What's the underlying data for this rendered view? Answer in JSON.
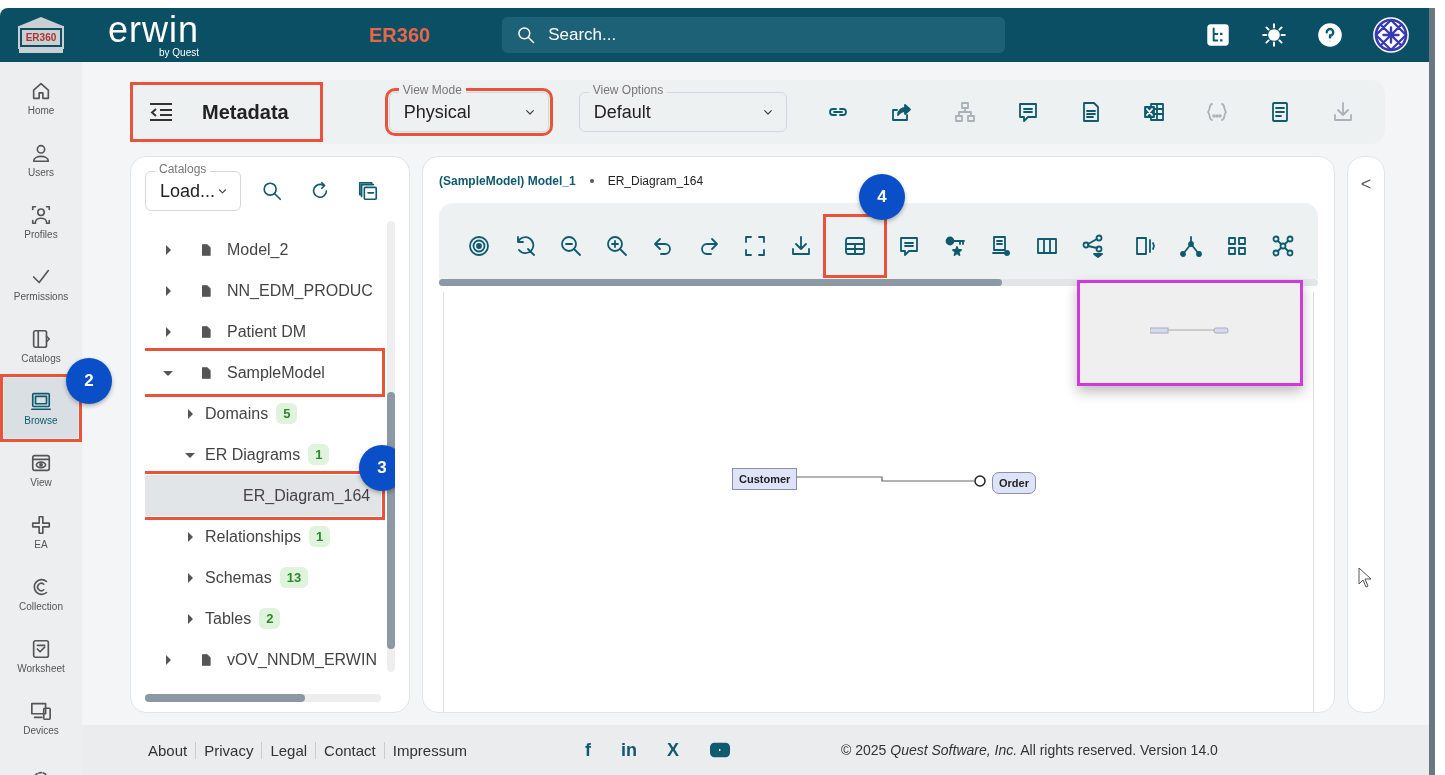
{
  "header": {
    "logo_badge": "ER360",
    "brand": "erwin",
    "brand_sub": "by Quest",
    "app_name": "ER360",
    "search": {
      "placeholder": "Search..."
    },
    "actions": [
      {
        "kind": "diagram"
      },
      {
        "kind": "theme"
      },
      {
        "kind": "help"
      },
      {
        "kind": "avatar"
      }
    ]
  },
  "nav": [
    {
      "kind": "home",
      "label": "Home",
      "selected": false,
      "highlighted": false
    },
    {
      "kind": "user",
      "label": "Users",
      "selected": false,
      "highlighted": false
    },
    {
      "kind": "profile",
      "label": "Profiles",
      "selected": false,
      "highlighted": false
    },
    {
      "kind": "check",
      "label": "Permissions",
      "selected": false,
      "highlighted": false
    },
    {
      "kind": "catalog",
      "label": "Catalogs",
      "selected": false,
      "highlighted": false
    },
    {
      "kind": "browse",
      "label": "Browse",
      "selected": true,
      "highlighted": true,
      "callout": "2"
    },
    {
      "kind": "view",
      "label": "View",
      "selected": false,
      "highlighted": false
    },
    {
      "kind": "ea",
      "label": "EA",
      "selected": false,
      "highlighted": false
    },
    {
      "kind": "collection",
      "label": "Collection",
      "selected": false,
      "highlighted": false
    },
    {
      "kind": "worksheet",
      "label": "Worksheet",
      "selected": false,
      "highlighted": false
    },
    {
      "kind": "devices",
      "label": "Devices",
      "selected": false,
      "highlighted": false
    },
    {
      "kind": "settings",
      "selected": false,
      "highlighted": false
    }
  ],
  "toolbar": {
    "title": "Metadata",
    "title_highlighted": true,
    "view_mode": {
      "label": "View Mode",
      "value": "Physical",
      "highlighted": true
    },
    "view_options": {
      "label": "View Options",
      "value": "Default",
      "highlighted": false
    },
    "actions": [
      {
        "kind": "link",
        "disabled": false
      },
      {
        "kind": "share",
        "disabled": false
      },
      {
        "kind": "hierarchy",
        "disabled": true
      },
      {
        "kind": "comment",
        "disabled": false
      },
      {
        "kind": "csv",
        "disabled": false
      },
      {
        "kind": "excel",
        "disabled": false
      },
      {
        "kind": "braces",
        "disabled": true
      },
      {
        "kind": "notes",
        "disabled": false
      },
      {
        "kind": "download",
        "disabled": true
      }
    ]
  },
  "catalogs": {
    "label": "Catalogs",
    "value": "Load..."
  },
  "tree": [
    {
      "kind": "model",
      "label": "Model_2",
      "expanded": false,
      "highlighted": false,
      "selected": false
    },
    {
      "kind": "model",
      "label": "NN_EDM_PRODUC",
      "expanded": false,
      "highlighted": false,
      "selected": false
    },
    {
      "kind": "model",
      "label": "Patient DM",
      "expanded": false,
      "highlighted": false,
      "selected": false
    },
    {
      "kind": "model",
      "label": "SampleModel",
      "expanded": true,
      "highlighted": true,
      "selected": false,
      "children": [
        {
          "kind": "folder",
          "label": "Domains",
          "count": "5",
          "expanded": false,
          "highlighted": false,
          "selected": false
        },
        {
          "kind": "folder",
          "label": "ER Diagrams",
          "count": "1",
          "expanded": true,
          "highlighted": false,
          "selected": false,
          "children": [
            {
              "kind": "leaf",
              "label": "ER_Diagram_164",
              "highlighted": true,
              "selected": true,
              "callout": "3"
            }
          ]
        },
        {
          "kind": "folder",
          "label": "Relationships",
          "count": "1",
          "expanded": false,
          "highlighted": false,
          "selected": false
        },
        {
          "kind": "folder",
          "label": "Schemas",
          "count": "13",
          "expanded": false,
          "highlighted": false,
          "selected": false
        },
        {
          "kind": "folder",
          "label": "Tables",
          "count": "2",
          "expanded": false,
          "highlighted": false,
          "selected": false
        }
      ]
    },
    {
      "kind": "model",
      "label": "vOV_NNDM_ERWIN",
      "expanded": false,
      "highlighted": false,
      "selected": false
    }
  ],
  "breadcrumb": [
    "(SampleModel) Model_1",
    "ER_Diagram_164"
  ],
  "diagram_tools": [
    {
      "kind": "target",
      "highlighted": false
    },
    {
      "kind": "reset-zoom",
      "highlighted": false
    },
    {
      "kind": "zoom-out",
      "highlighted": false
    },
    {
      "kind": "zoom-in",
      "highlighted": false
    },
    {
      "kind": "undo",
      "highlighted": false
    },
    {
      "kind": "redo",
      "highlighted": false
    },
    {
      "kind": "fit",
      "highlighted": false
    },
    {
      "kind": "download",
      "highlighted": false
    },
    {
      "kind": "table",
      "highlighted": true,
      "callout": "4"
    },
    {
      "kind": "comment",
      "highlighted": false
    },
    {
      "kind": "key",
      "highlighted": false
    },
    {
      "kind": "server",
      "highlighted": false
    },
    {
      "kind": "columns",
      "highlighted": false
    },
    {
      "kind": "share-menu",
      "highlighted": false
    },
    {
      "kind": "split",
      "highlighted": false
    },
    {
      "kind": "fork",
      "highlighted": false
    },
    {
      "kind": "grid",
      "highlighted": false
    },
    {
      "kind": "nodes",
      "highlighted": false
    }
  ],
  "entities": [
    {
      "name": "Customer",
      "kind": "independent"
    },
    {
      "name": "Order",
      "kind": "dependent"
    }
  ],
  "collapse": "<",
  "footer": {
    "links": [
      "About",
      "Privacy",
      "Legal",
      "Contact",
      "Impressum"
    ],
    "social": [
      {
        "kind": "text",
        "glyph": "f"
      },
      {
        "kind": "text",
        "glyph": "in"
      },
      {
        "kind": "text",
        "glyph": "X"
      },
      {
        "kind": "youtube"
      }
    ],
    "copyright": "© 2025 *Quest Software, Inc.* All rights reserved. Version 14.0"
  }
}
